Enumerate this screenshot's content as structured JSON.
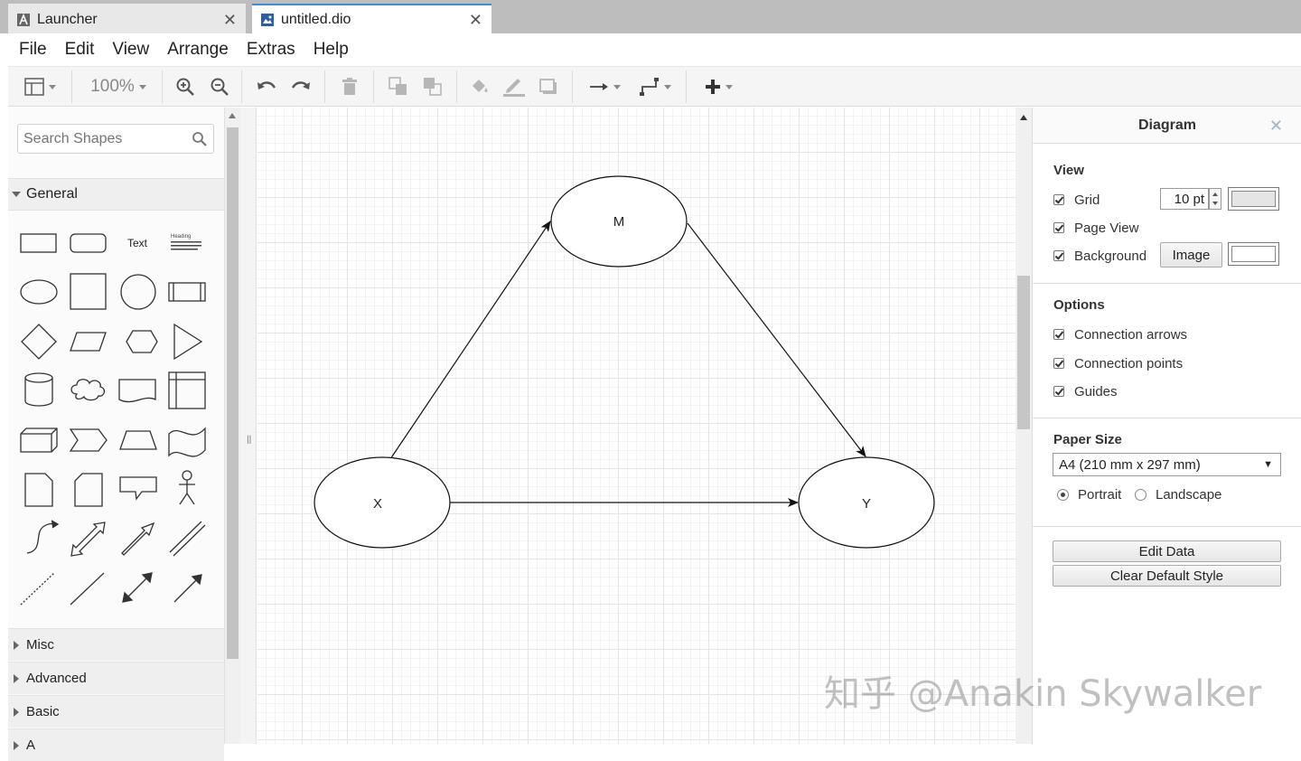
{
  "tabs": [
    {
      "label": "Launcher",
      "close": "✕"
    },
    {
      "label": "untitled.dio",
      "close": "✕"
    }
  ],
  "menu": [
    "File",
    "Edit",
    "View",
    "Arrange",
    "Extras",
    "Help"
  ],
  "toolbar": {
    "zoom": "100%",
    "icons": [
      "format-panel-icon",
      "zoom-in-icon",
      "zoom-out-icon",
      "undo-icon",
      "redo-icon",
      "delete-icon",
      "to-front-icon",
      "to-back-icon",
      "fill-color-icon",
      "line-color-icon",
      "shadow-icon",
      "connection-icon",
      "waypoints-icon",
      "insert-icon"
    ]
  },
  "left_panel": {
    "search_placeholder": "Search Shapes",
    "general_label": "General",
    "text_shape": "Text",
    "heading_shape": "Heading",
    "categories": [
      "Misc",
      "Advanced",
      "Basic",
      "A"
    ]
  },
  "diagram": {
    "nodes": [
      {
        "id": "M",
        "label": "M"
      },
      {
        "id": "X",
        "label": "X"
      },
      {
        "id": "Y",
        "label": "Y"
      }
    ],
    "edges": [
      {
        "from": "X",
        "to": "M"
      },
      {
        "from": "M",
        "to": "Y"
      },
      {
        "from": "X",
        "to": "Y"
      }
    ]
  },
  "right_panel": {
    "title": "Diagram",
    "close": "✕",
    "view": {
      "title": "View",
      "grid_label": "Grid",
      "grid_size": "10 pt",
      "page_view_label": "Page View",
      "background_label": "Background",
      "image_button": "Image"
    },
    "options": {
      "title": "Options",
      "connection_arrows": "Connection arrows",
      "connection_points": "Connection points",
      "guides": "Guides"
    },
    "paper": {
      "title": "Paper Size",
      "size": "A4 (210 mm x 297 mm)",
      "portrait": "Portrait",
      "landscape": "Landscape"
    },
    "buttons": {
      "edit_data": "Edit Data",
      "clear_default_style": "Clear Default Style"
    }
  },
  "watermark": "知乎 @Anakin Skywalker",
  "colors": {
    "tab_accent": "#3c8fd8",
    "grid_line": "#e5e5e5"
  }
}
